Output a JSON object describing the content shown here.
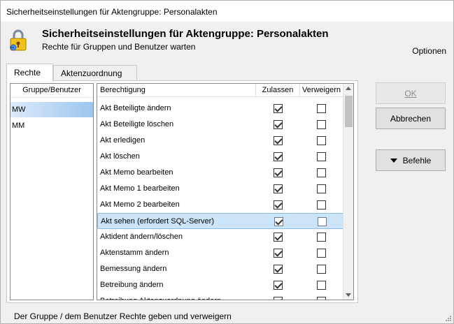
{
  "window": {
    "title": "Sicherheitseinstellungen für Aktengruppe: Personalakten"
  },
  "header": {
    "title": "Sicherheitseinstellungen für Aktengruppe: Personalakten",
    "subtitle": "Rechte für Gruppen und Benutzer warten",
    "options_label": "Optionen",
    "icon": "lock-key-icon"
  },
  "tabs": [
    {
      "label": "Rechte",
      "active": true
    },
    {
      "label": "Aktenzuordnung",
      "active": false
    }
  ],
  "groups": {
    "header": "Gruppe/Benutzer",
    "items": [
      {
        "label": "MW",
        "selected": true
      },
      {
        "label": "MM",
        "selected": false
      }
    ]
  },
  "permissions": {
    "columns": {
      "name": "Berechtigung",
      "allow": "Zulassen",
      "deny": "Verweigern"
    },
    "rows": [
      {
        "label": "Akt Beteiligte ändern",
        "allow": true,
        "deny": false
      },
      {
        "label": "Akt Beteiligte löschen",
        "allow": true,
        "deny": false
      },
      {
        "label": "Akt erledigen",
        "allow": true,
        "deny": false
      },
      {
        "label": "Akt löschen",
        "allow": true,
        "deny": false
      },
      {
        "label": "Akt Memo bearbeiten",
        "allow": true,
        "deny": false
      },
      {
        "label": "Akt Memo 1 bearbeiten",
        "allow": true,
        "deny": false
      },
      {
        "label": "Akt Memo 2 bearbeiten",
        "allow": true,
        "deny": false
      },
      {
        "label": "Akt sehen (erfordert SQL-Server)",
        "allow": true,
        "deny": false,
        "selected": true
      },
      {
        "label": "Aktident ändern/löschen",
        "allow": true,
        "deny": false
      },
      {
        "label": "Aktenstamm ändern",
        "allow": true,
        "deny": false
      },
      {
        "label": "Bemessung ändern",
        "allow": true,
        "deny": false
      },
      {
        "label": "Betreibung ändern",
        "allow": true,
        "deny": false
      },
      {
        "label": "Betreibung Aktenzuordnung ändern",
        "allow": true,
        "deny": false
      }
    ]
  },
  "buttons": {
    "ok": "OK",
    "cancel": "Abbrechen",
    "commands": "Befehle"
  },
  "status": {
    "text": "Der Gruppe / dem Benutzer Rechte geben und verweigern"
  }
}
